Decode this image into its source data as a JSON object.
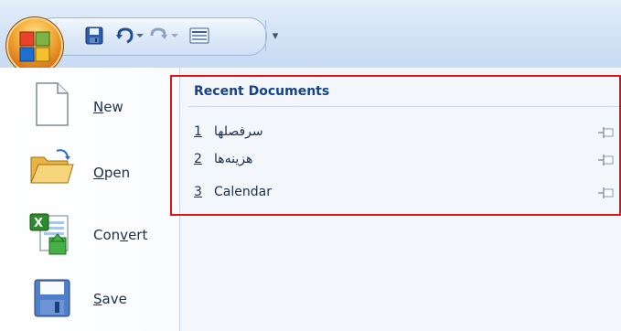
{
  "qat": {
    "items": [
      "save-icon",
      "undo-icon",
      "redo-icon",
      "quick-print-icon"
    ],
    "customize": "▾"
  },
  "menu": {
    "items": [
      {
        "label": "New",
        "underline": "N",
        "rest": "ew"
      },
      {
        "label": "Open",
        "underline": "O",
        "rest": "pen"
      },
      {
        "label": "Convert",
        "prefix": "Con",
        "underline": "v",
        "rest": "ert"
      },
      {
        "label": "Save",
        "underline": "S",
        "rest": "ave"
      }
    ]
  },
  "recent": {
    "header": "Recent Documents",
    "documents": [
      {
        "number": "1",
        "name": "سرفصلها"
      },
      {
        "number": "2",
        "name": "هزینه‌ها"
      },
      {
        "number": "3",
        "name": "Calendar"
      }
    ]
  },
  "colors": {
    "highlight": "#e01515",
    "header": "#15428b"
  }
}
